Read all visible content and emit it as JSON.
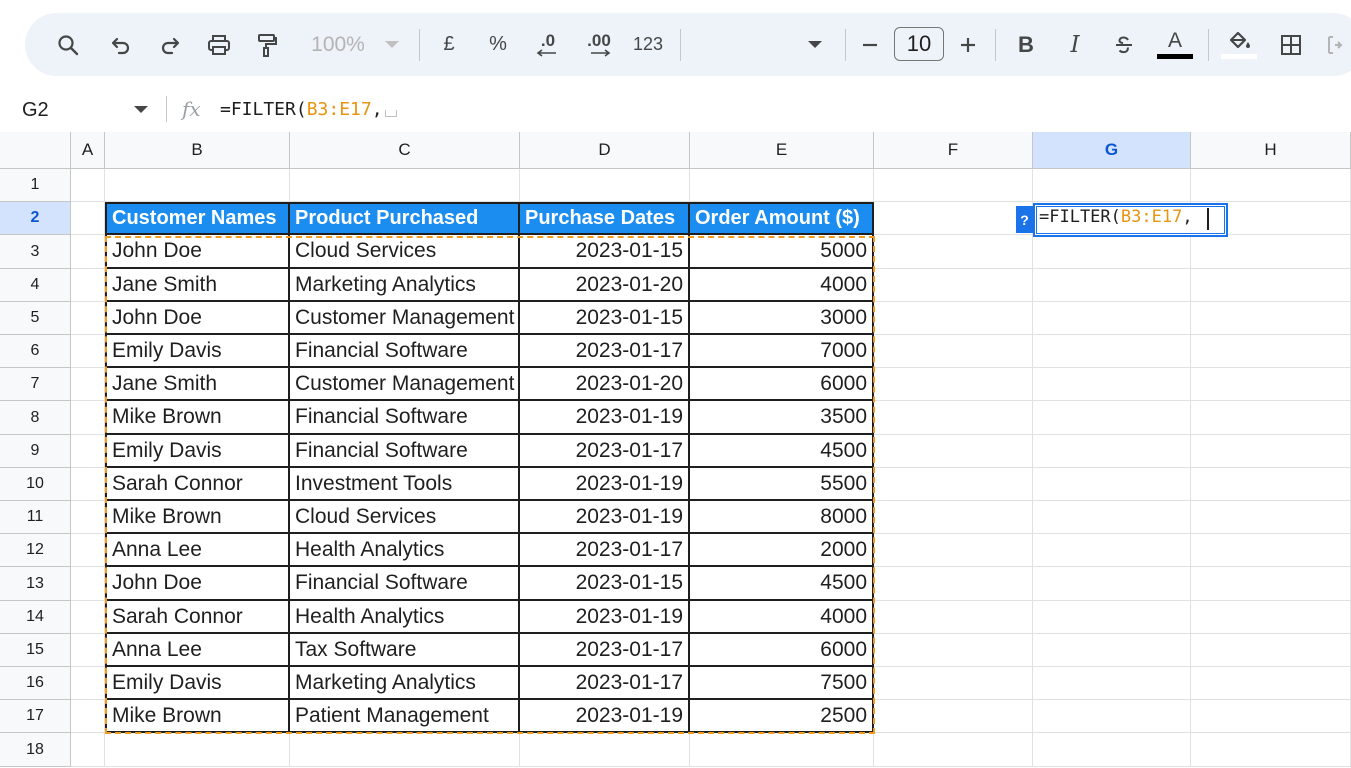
{
  "toolbar": {
    "zoom": "100%",
    "currency": "£",
    "percent": "%",
    "decrease_decimal": ".0",
    "increase_decimal": ".00",
    "number_format": "123",
    "font_size": "10",
    "bold": "B",
    "italic": "I",
    "text_color_letter": "A",
    "colors": {
      "text_color_bar": "#000000",
      "fill_color_bar": "#ffffff"
    }
  },
  "formula_bar": {
    "cell_ref": "G2",
    "fx": "fx",
    "formula_prefix": "=FILTER(",
    "formula_range": "B3:E17",
    "formula_suffix": ","
  },
  "columns": [
    "A",
    "B",
    "C",
    "D",
    "E",
    "F",
    "G",
    "H"
  ],
  "rows": [
    "1",
    "2",
    "3",
    "4",
    "5",
    "6",
    "7",
    "8",
    "9",
    "10",
    "11",
    "12",
    "13",
    "14",
    "15",
    "16",
    "17",
    "18"
  ],
  "table": {
    "headers": [
      "Customer Names",
      "Product Purchased",
      "Purchase Dates",
      "Order Amount ($)"
    ],
    "rows": [
      [
        "John Doe",
        "Cloud Services",
        "2023-01-15",
        "5000"
      ],
      [
        "Jane Smith",
        "Marketing Analytics",
        "2023-01-20",
        "4000"
      ],
      [
        "John Doe",
        "Customer Management",
        "2023-01-15",
        "3000"
      ],
      [
        "Emily Davis",
        "Financial Software",
        "2023-01-17",
        "7000"
      ],
      [
        "Jane Smith",
        "Customer Management",
        "2023-01-20",
        "6000"
      ],
      [
        "Mike Brown",
        "Financial Software",
        "2023-01-19",
        "3500"
      ],
      [
        "Emily Davis",
        "Financial Software",
        "2023-01-17",
        "4500"
      ],
      [
        "Sarah Connor",
        "Investment Tools",
        "2023-01-19",
        "5500"
      ],
      [
        "Mike Brown",
        "Cloud Services",
        "2023-01-19",
        "8000"
      ],
      [
        "Anna Lee",
        "Health Analytics",
        "2023-01-17",
        "2000"
      ],
      [
        "John Doe",
        "Financial Software",
        "2023-01-15",
        "4500"
      ],
      [
        "Sarah Connor",
        "Health Analytics",
        "2023-01-19",
        "4000"
      ],
      [
        "Anna Lee",
        "Tax Software",
        "2023-01-17",
        "6000"
      ],
      [
        "Emily Davis",
        "Marketing Analytics",
        "2023-01-17",
        "7500"
      ],
      [
        "Mike Brown",
        "Patient Management",
        "2023-01-19",
        "2500"
      ]
    ]
  },
  "active_cell": {
    "help": "?",
    "formula_prefix": "=FILTER(",
    "formula_range": "B3:E17",
    "formula_suffix": ","
  },
  "theme": {
    "header_fill": "#1b8cf0",
    "selection_blue": "#1a73e8",
    "range_highlight": "#f29c1f"
  }
}
